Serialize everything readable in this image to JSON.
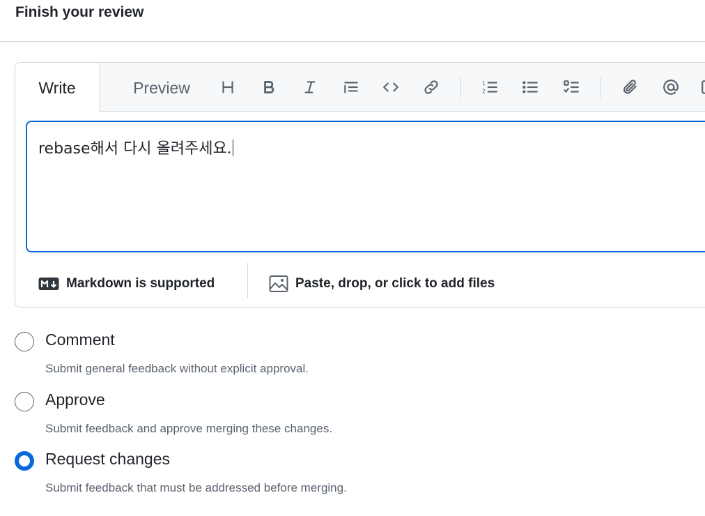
{
  "header": {
    "title": "Finish your review"
  },
  "editor": {
    "tabs": [
      {
        "label": "Write",
        "active": true
      },
      {
        "label": "Preview",
        "active": false
      }
    ],
    "toolbar_icons": [
      "heading-icon",
      "bold-icon",
      "italic-icon",
      "quote-icon",
      "code-icon",
      "link-icon",
      "numbered-list-icon",
      "unordered-list-icon",
      "task-list-icon",
      "attach-icon",
      "mention-icon",
      "reference-icon"
    ],
    "body_text": "rebase해서 다시 올려주세요.",
    "footer": {
      "markdown_label": "Markdown is supported",
      "files_label": "Paste, drop, or click to add files"
    }
  },
  "review_options": [
    {
      "label": "Comment",
      "description": "Submit general feedback without explicit approval.",
      "selected": false
    },
    {
      "label": "Approve",
      "description": "Submit feedback and approve merging these changes.",
      "selected": false
    },
    {
      "label": "Request changes",
      "description": "Submit feedback that must be addressed before merging.",
      "selected": true
    }
  ],
  "colors": {
    "accent": "#0969da",
    "border": "#d0d7de",
    "muted_text": "#59636e",
    "text": "#1f2328"
  }
}
